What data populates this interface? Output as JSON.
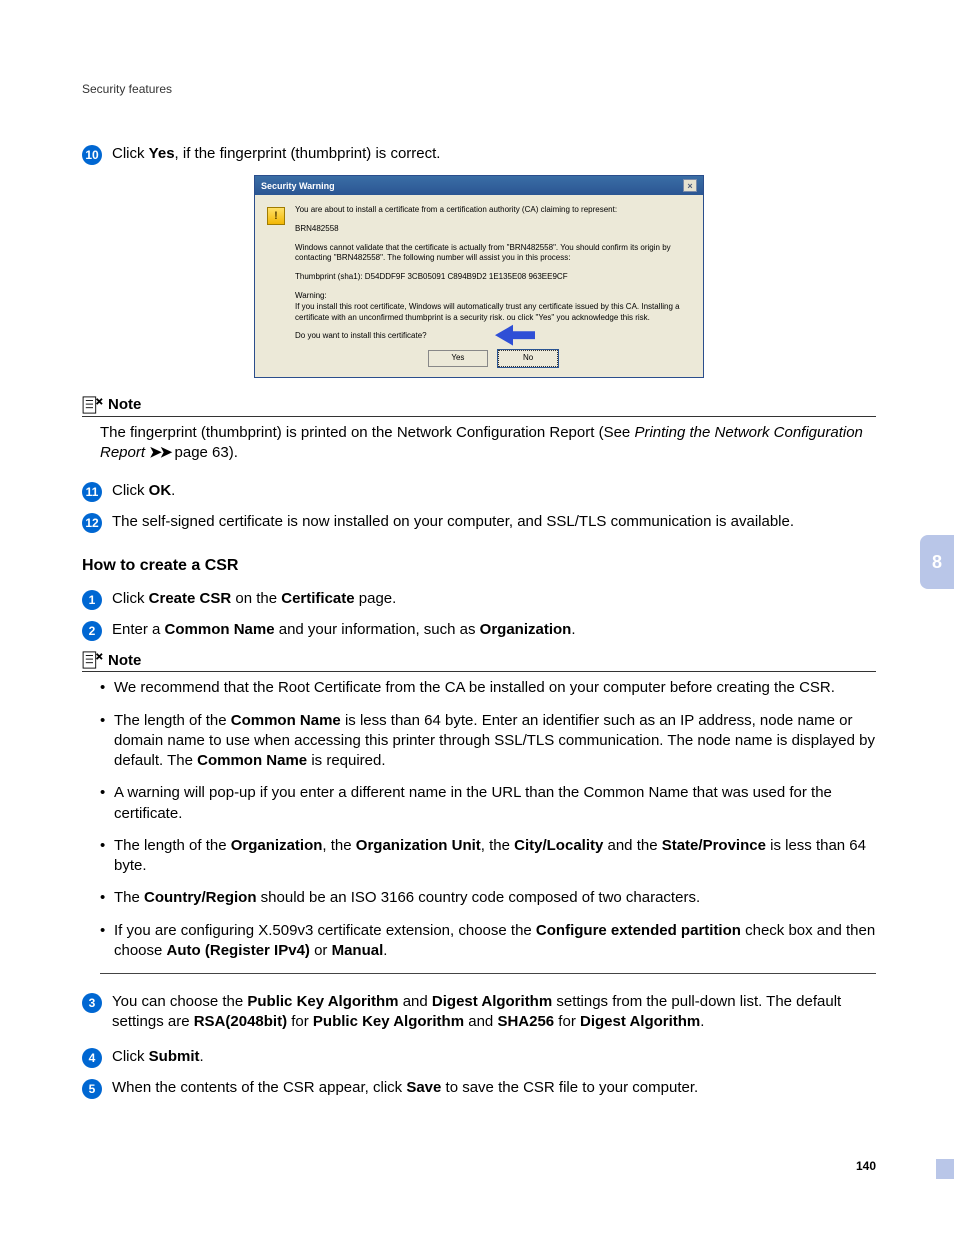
{
  "header": {
    "section_title": "Security features"
  },
  "chapter_tab": "8",
  "page_number": "140",
  "steps_a": {
    "s10": {
      "num": "10",
      "pre": "Click ",
      "bold": "Yes",
      "post": ", if the fingerprint (thumbprint) is correct."
    },
    "s11": {
      "num": "11",
      "pre": "Click ",
      "bold": "OK",
      "post": "."
    },
    "s12": {
      "num": "12",
      "text": "The self-signed certificate is now installed on your computer, and SSL/TLS communication is available."
    }
  },
  "dialog": {
    "title": "Security Warning",
    "line1": "You are about to install a certificate from a certification authority (CA) claiming to represent:",
    "line2": "BRN482558",
    "line3": "Windows cannot validate that the certificate is actually from \"BRN482558\". You should confirm its origin by contacting \"BRN482558\". The following number will assist you in this process:",
    "line4": "Thumbprint (sha1): D54DDF9F 3CB05091 C894B9D2 1E135E08 963EE9CF",
    "line5a": "Warning:",
    "line5b": "If you install this root certificate, Windows will automatically trust any certificate issued by this CA. Installing a certificate with an unconfirmed thumbprint is a security risk.       ou click \"Yes\" you acknowledge this risk.",
    "line6": "Do you want to install this certificate?",
    "btn_yes": "Yes",
    "btn_no": "No"
  },
  "note1": {
    "label": "Note",
    "text_pre": "The fingerprint (thumbprint) is printed on the Network Configuration Report (See ",
    "xref": "Printing the Network Configuration Report",
    "text_post": " page 63)."
  },
  "section2": {
    "heading": "How to create a CSR",
    "s1": {
      "num": "1",
      "pre": "Click ",
      "b1": "Create CSR",
      "mid": " on the ",
      "b2": "Certificate",
      "post": " page."
    },
    "s2": {
      "num": "2",
      "pre": "Enter a ",
      "b1": "Common Name",
      "mid": " and your information, such as ",
      "b2": "Organization",
      "post": "."
    },
    "s3": {
      "num": "3",
      "t1": "You can choose the ",
      "b1": "Public Key Algorithm",
      "t2": " and ",
      "b2": "Digest Algorithm",
      "t3": " settings from the pull-down list. The default settings are ",
      "b3": "RSA(2048bit)",
      "t4": " for ",
      "b4": "Public Key Algorithm",
      "t5": " and ",
      "b5": "SHA256",
      "t6": " for ",
      "b6": "Digest Algorithm",
      "t7": "."
    },
    "s4": {
      "num": "4",
      "pre": "Click ",
      "b1": "Submit",
      "post": "."
    },
    "s5": {
      "num": "5",
      "pre": "When the contents of the CSR appear, click ",
      "b1": "Save",
      "post": " to save the CSR file to your computer."
    }
  },
  "note2": {
    "label": "Note",
    "items": {
      "i1": "We recommend that the Root Certificate from the CA be installed on your computer before creating the CSR.",
      "i2": {
        "t1": "The length of the ",
        "b1": "Common Name",
        "t2": " is less than 64 byte. Enter an identifier such as an IP address, node name or domain name to use when accessing this printer through SSL/TLS communication. The node name is displayed by default. The ",
        "b2": "Common Name",
        "t3": " is required."
      },
      "i3": "A warning will pop-up if you enter a different name in the URL than the Common Name that was used for the certificate.",
      "i4": {
        "t1": "The length of the ",
        "b1": "Organization",
        "t2": ", the ",
        "b2": "Organization Unit",
        "t3": ", the ",
        "b3": "City/Locality",
        "t4": " and the ",
        "b4": "State/Province",
        "t5": " is less than 64 byte."
      },
      "i5": {
        "t1": "The ",
        "b1": "Country/Region",
        "t2": " should be an ISO 3166 country code composed of two characters."
      },
      "i6": {
        "t1": "If you are configuring X.509v3 certificate extension, choose the ",
        "b1": "Configure extended partition",
        "t2": " check box and then choose ",
        "b2": "Auto (Register IPv4)",
        "t3": " or ",
        "b3": "Manual",
        "t4": "."
      }
    }
  }
}
